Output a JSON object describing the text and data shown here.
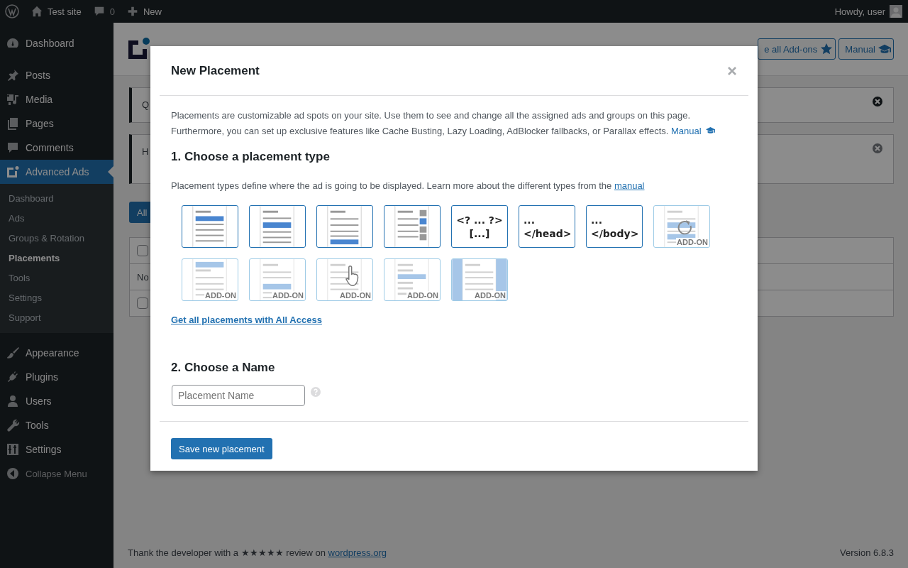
{
  "admin_bar": {
    "site": "Test site",
    "comments": "0",
    "new": "New",
    "greeting": "Howdy, user"
  },
  "sidebar": {
    "items": [
      {
        "label": "Dashboard",
        "selected": false
      },
      {
        "label": "Posts",
        "selected": false
      },
      {
        "label": "Media",
        "selected": false
      },
      {
        "label": "Pages",
        "selected": false
      },
      {
        "label": "Comments",
        "selected": false
      },
      {
        "label": "Advanced Ads",
        "selected": true,
        "children": [
          {
            "label": "Dashboard",
            "selected": false
          },
          {
            "label": "Ads",
            "selected": false
          },
          {
            "label": "Groups & Rotation",
            "selected": false
          },
          {
            "label": "Placements",
            "selected": true
          },
          {
            "label": "Tools",
            "selected": false
          },
          {
            "label": "Settings",
            "selected": false
          },
          {
            "label": "Support",
            "selected": false
          }
        ]
      },
      {
        "label": "Appearance",
        "selected": false
      },
      {
        "label": "Plugins",
        "selected": false
      },
      {
        "label": "Users",
        "selected": false
      },
      {
        "label": "Tools",
        "selected": false
      },
      {
        "label": "Settings",
        "selected": false
      }
    ],
    "collapse": "Collapse Menu"
  },
  "header": {
    "buttons": [
      {
        "label": "e all Add-ons"
      },
      {
        "label": "Manual"
      }
    ]
  },
  "notices": [
    {
      "text": "Q"
    },
    {
      "text": "H"
    }
  ],
  "filter": {
    "label": "All"
  },
  "table": {
    "rows": [
      {
        "kind": "checkbox",
        "checked": false
      },
      {
        "kind": "text",
        "text": "No"
      },
      {
        "kind": "checkbox",
        "checked": false
      }
    ]
  },
  "footer": {
    "text": "Thank the developer with a ★★★★★ review on",
    "link": "wordpress.org",
    "version": "Version 6.8.3"
  },
  "modal": {
    "title": "New Placement",
    "intro": "Placements are customizable ad spots on your site. Use them to see and change all the assigned ads and groups on this page. Furthermore, you can set up exclusive features like Cache Busting, Lazy Loading, AdBlocker fallbacks, or Parallax effects.",
    "intro_link": "Manual",
    "section1": {
      "heading": "1. Choose a placement type",
      "text": "Placement types define where the ad is going to be displayed. Learn more about the different types from the",
      "link": "manual"
    },
    "types": [
      {
        "kind": "before"
      },
      {
        "kind": "content"
      },
      {
        "kind": "after"
      },
      {
        "kind": "sidebar"
      },
      {
        "kind": "code",
        "lines": [
          "<? ... ?>",
          "[...]"
        ]
      },
      {
        "kind": "code",
        "lines": [
          "...",
          "</head>"
        ]
      },
      {
        "kind": "code",
        "lines": [
          "...",
          "</body>"
        ]
      },
      {
        "kind": "cache",
        "badge": "ADD-ON"
      },
      {
        "kind": "above",
        "badge": "ADD-ON"
      },
      {
        "kind": "middle",
        "badge": "ADD-ON"
      },
      {
        "kind": "custom",
        "badge": "ADD-ON"
      },
      {
        "kind": "archive",
        "badge": "ADD-ON"
      },
      {
        "kind": "background",
        "badge": "ADD-ON"
      }
    ],
    "access_link": "Get all placements with All Access",
    "section2": {
      "heading": "2. Choose a Name",
      "placeholder": "Placement Name"
    },
    "save": "Save new placement"
  }
}
